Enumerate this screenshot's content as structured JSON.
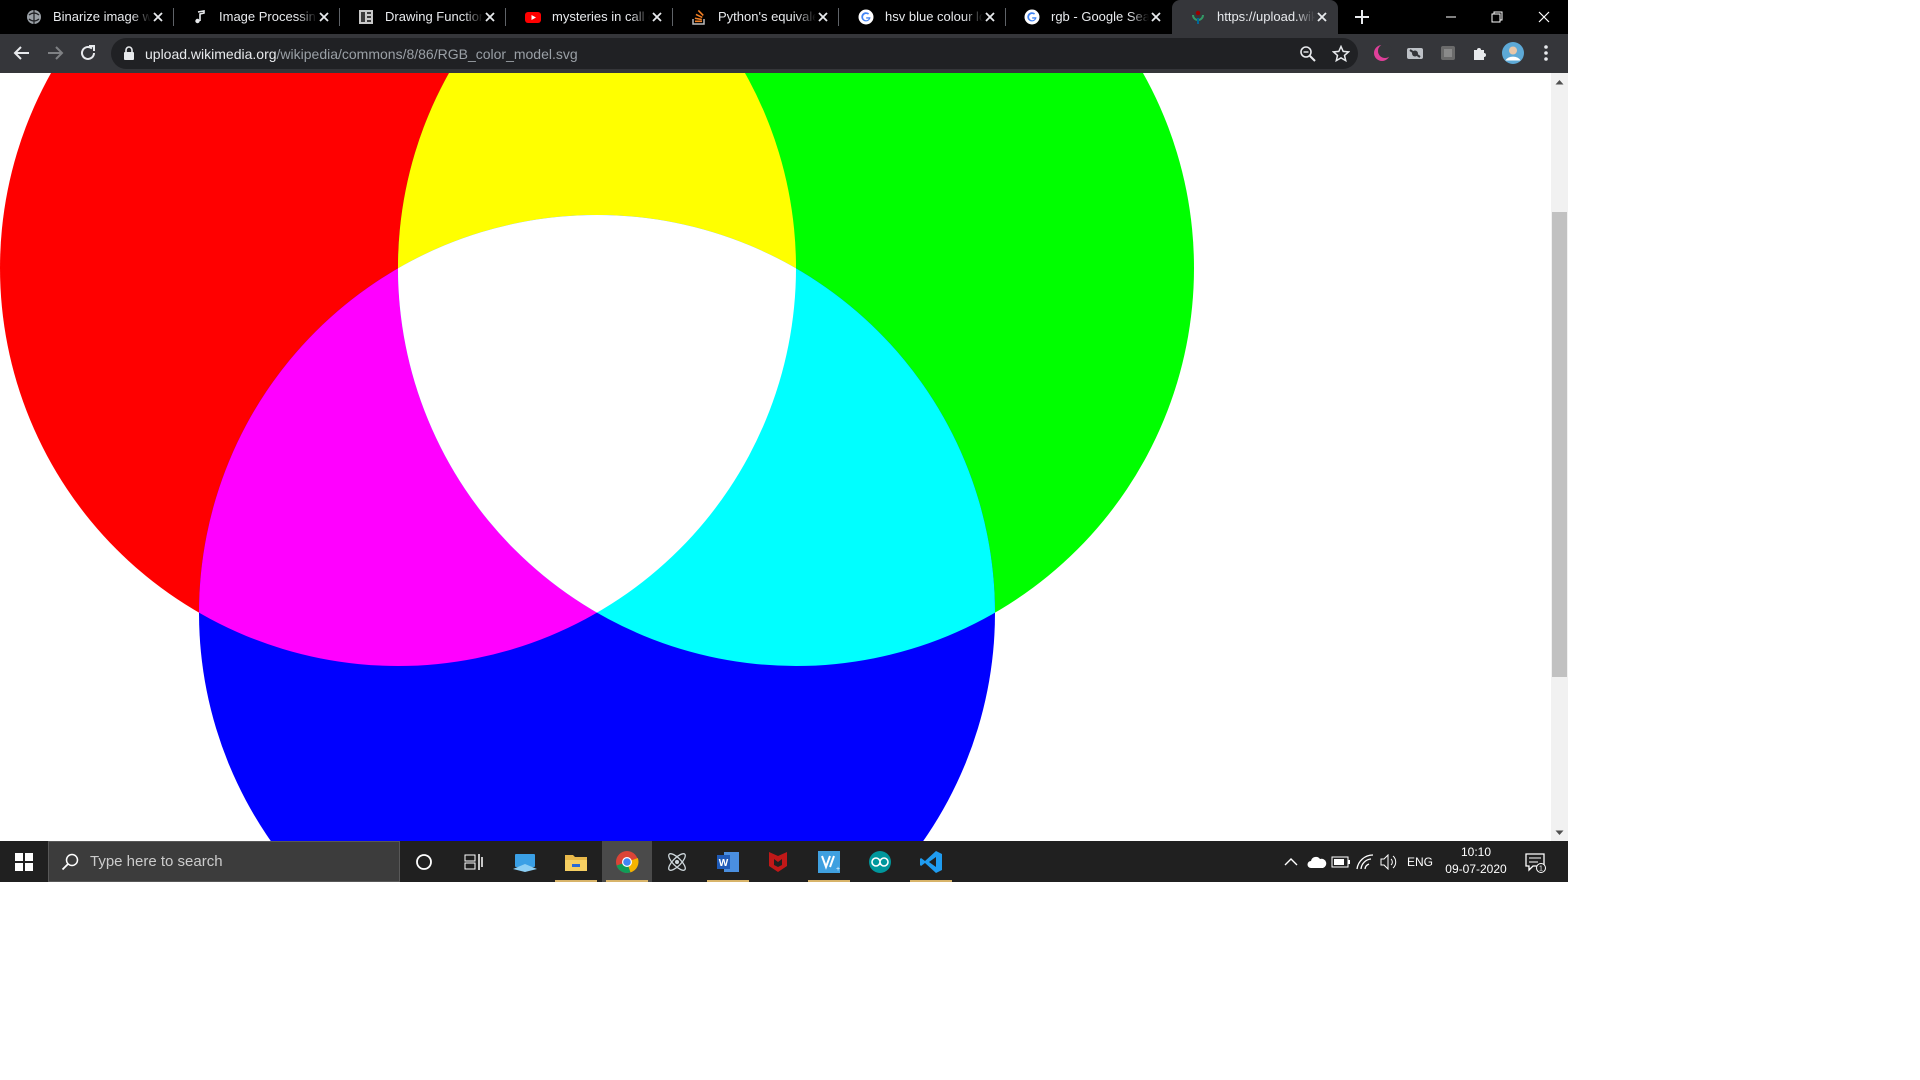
{
  "browser": {
    "tabs": [
      {
        "title": "Binarize image with",
        "favicon": "globe-icon",
        "active": false
      },
      {
        "title": "Image Processing",
        "favicon": "music-note-icon",
        "active": false
      },
      {
        "title": "Drawing Functions",
        "favicon": "docs-book-icon",
        "active": false
      },
      {
        "title": "mysteries in call of",
        "favicon": "youtube-icon",
        "active": false
      },
      {
        "title": "Python's equivalent",
        "favicon": "stack-overflow-icon",
        "active": false
      },
      {
        "title": "hsv blue colour low",
        "favicon": "google-icon",
        "active": false
      },
      {
        "title": "rgb - Google Search",
        "favicon": "google-icon",
        "active": false
      },
      {
        "title": "https://upload.wikimedia.org",
        "favicon": "wikimedia-icon",
        "active": true
      }
    ],
    "address_bar": {
      "host": "upload.wikimedia.org",
      "path": "/wikipedia/commons/8/86/RGB_color_model.svg"
    }
  },
  "content": {
    "image_name": "RGB_color_model.svg",
    "colors": {
      "red": "#ff0000",
      "green": "#00ff00",
      "blue": "#0000ff",
      "yellow": "#ffff00",
      "cyan": "#00ffff",
      "magenta": "#ff00ff",
      "white": "#ffffff"
    }
  },
  "taskbar": {
    "search_placeholder": "Type here to search",
    "apps": [
      "cortana-circle-icon",
      "task-view-icon",
      "desktop-app-icon",
      "file-explorer-icon",
      "chrome-icon",
      "atom-icon",
      "word-icon",
      "mcafee-icon",
      "vs-icon",
      "arduino-icon",
      "vscode-icon"
    ],
    "language": "ENG",
    "time": "10:10",
    "date": "09-07-2020",
    "notification_count": "1"
  }
}
